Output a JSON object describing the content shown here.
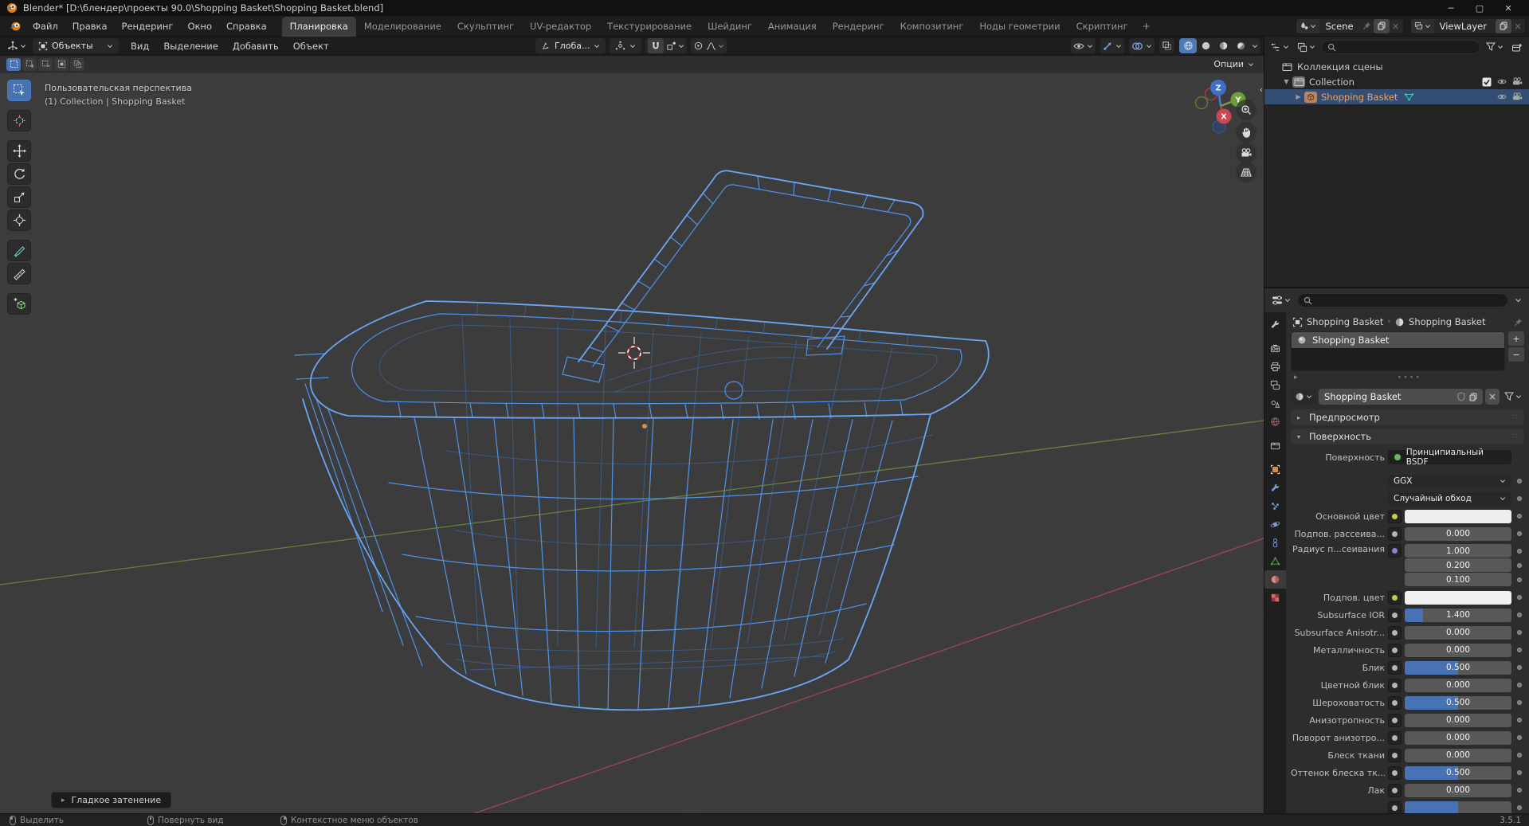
{
  "window": {
    "title": "Blender* [D:\\блендер\\проекты 90.0\\Shopping Basket\\Shopping Basket.blend]"
  },
  "topbar": {
    "menus": [
      {
        "slug": "file",
        "label": "Файл"
      },
      {
        "slug": "edit",
        "label": "Правка"
      },
      {
        "slug": "render",
        "label": "Рендеринг"
      },
      {
        "slug": "window",
        "label": "Окно"
      },
      {
        "slug": "help",
        "label": "Справка"
      }
    ],
    "workspaces": [
      {
        "slug": "layout",
        "label": "Планировка",
        "active": true
      },
      {
        "slug": "modeling",
        "label": "Моделирование"
      },
      {
        "slug": "sculpting",
        "label": "Скульптинг"
      },
      {
        "slug": "uv-editing",
        "label": "UV-редактор"
      },
      {
        "slug": "texture-paint",
        "label": "Текстурирование"
      },
      {
        "slug": "shading",
        "label": "Шейдинг"
      },
      {
        "slug": "animation",
        "label": "Анимация"
      },
      {
        "slug": "rendering",
        "label": "Рендеринг"
      },
      {
        "slug": "compositing",
        "label": "Композитинг"
      },
      {
        "slug": "geometry-nodes",
        "label": "Ноды геометрии"
      },
      {
        "slug": "scripting",
        "label": "Скриптинг"
      }
    ],
    "add_workspace": "+",
    "scene": {
      "value": "Scene"
    },
    "view_layer": {
      "value": "ViewLayer"
    }
  },
  "viewport": {
    "header": {
      "mode": "Объекты",
      "menus": [
        {
          "slug": "view",
          "label": "Вид"
        },
        {
          "slug": "select",
          "label": "Выделение"
        },
        {
          "slug": "add",
          "label": "Добавить"
        },
        {
          "slug": "object",
          "label": "Объект"
        }
      ],
      "orientation": "Глоба...",
      "options": "Опции"
    },
    "tools": [
      {
        "slug": "select-box",
        "active": true
      },
      {
        "slug": "cursor"
      },
      {
        "slug": "move"
      },
      {
        "slug": "rotate"
      },
      {
        "slug": "scale"
      },
      {
        "slug": "transform"
      },
      {
        "slug": "annotate"
      },
      {
        "slug": "measure"
      },
      {
        "slug": "add-cube"
      }
    ],
    "overlay": {
      "view_name": "Пользовательская перспектива",
      "context": "(1) Collection | Shopping Basket"
    },
    "gizmo_axes": [
      "Z",
      "Y",
      "X"
    ],
    "operator_panel": "Гладкое затенение"
  },
  "outliner": {
    "rows": [
      {
        "slug": "scene-collection",
        "label": "Коллекция сцены",
        "depth": 0
      },
      {
        "slug": "collection",
        "label": "Collection",
        "depth": 1,
        "expanded": true,
        "checkbox": true,
        "eye": true,
        "camera": true
      },
      {
        "slug": "shopping-basket",
        "label": "Shopping Basket",
        "depth": 2,
        "selected": true,
        "modifier": true,
        "eye": true,
        "camera": true
      }
    ]
  },
  "properties": {
    "tabs": [
      {
        "slug": "tool"
      },
      {
        "slug": "render"
      },
      {
        "slug": "output"
      },
      {
        "slug": "view-layer"
      },
      {
        "slug": "scene"
      },
      {
        "slug": "world"
      },
      {
        "slug": "collection"
      },
      {
        "slug": "object"
      },
      {
        "slug": "modifiers"
      },
      {
        "slug": "particles"
      },
      {
        "slug": "physics"
      },
      {
        "slug": "constraints"
      },
      {
        "slug": "object-data"
      },
      {
        "slug": "material",
        "active": true
      },
      {
        "slug": "texture"
      }
    ],
    "breadcrumb": {
      "object": "Shopping Basket",
      "material": "Shopping Basket"
    },
    "slot": {
      "name": "Shopping Basket"
    },
    "datablock": {
      "name": "Shopping Basket"
    },
    "panels": [
      {
        "slug": "preview",
        "label": "Предпросмотр",
        "expanded": false
      },
      {
        "slug": "surface",
        "label": "Поверхность",
        "expanded": true
      }
    ],
    "fields": [
      {
        "type": "ref",
        "label": "Поверхность",
        "value": "Принципиальный BSDF",
        "socket": "#63b763"
      },
      {
        "type": "select",
        "value": "GGX",
        "gap": true
      },
      {
        "type": "select",
        "value": "Случайный обход"
      },
      {
        "type": "color",
        "label": "Основной цвет",
        "socket": "#c9c94a",
        "swatch": "#eceef0"
      },
      {
        "type": "num",
        "label": "Подпов. рассеива...",
        "value": "0.000",
        "fill": 0
      },
      {
        "type": "vec3",
        "label": "Радиус п...сеивания",
        "socket": "#8d7fd6",
        "values": [
          "1.000",
          "0.200",
          "0.100"
        ]
      },
      {
        "type": "color",
        "label": "Подпов. цвет",
        "socket": "#c9c94a",
        "swatch": "#f1f1f4"
      },
      {
        "type": "num",
        "label": "Subsurface IOR",
        "value": "1.400",
        "fill": 0.17
      },
      {
        "type": "num",
        "label": "Subsurface Anisotr...",
        "value": "0.000",
        "fill": 0
      },
      {
        "type": "num",
        "label": "Металличность",
        "value": "0.000",
        "fill": 0
      },
      {
        "type": "num",
        "label": "Блик",
        "value": "0.500",
        "fill": 0.5
      },
      {
        "type": "num",
        "label": "Цветной блик",
        "value": "0.000",
        "fill": 0
      },
      {
        "type": "num",
        "label": "Шероховатость",
        "value": "0.500",
        "fill": 0.5
      },
      {
        "type": "num",
        "label": "Анизотропность",
        "value": "0.000",
        "fill": 0
      },
      {
        "type": "num",
        "label": "Поворот анизотро...",
        "value": "0.000",
        "fill": 0
      },
      {
        "type": "num",
        "label": "Блеск ткани",
        "value": "0.000",
        "fill": 0
      },
      {
        "type": "num",
        "label": "Оттенок блеска тк...",
        "value": "0.500",
        "fill": 0.5
      },
      {
        "type": "num",
        "label": "Лак",
        "value": "0.000",
        "fill": 0
      },
      {
        "type": "num",
        "label": "",
        "value": "",
        "fill": 0.5
      }
    ]
  },
  "statusbar": {
    "hints": [
      {
        "slug": "select",
        "button": "left",
        "label": "Выделить"
      },
      {
        "slug": "rotate-view",
        "button": "middle",
        "label": "Повернуть вид"
      },
      {
        "slug": "object-context-menu",
        "button": "right",
        "label": "Контекстное меню объектов"
      }
    ],
    "version": "3.5.1"
  },
  "icons": {
    "search-icon": "magnifier",
    "filter-icon": "funnel",
    "pin-icon": "pin",
    "copy-icon": "two-pages",
    "close-icon": "cross",
    "eye-icon": "eye",
    "camera-icon": "movie-camera",
    "checkbox-icon": "checked-box",
    "magnet-icon": "snap-magnet",
    "chevron-down-icon": "v",
    "blender-logo-icon": "orange-swirl",
    "modifier-icon": "teal-triangle",
    "collection-icon": "archive-box",
    "material-icon": "red-sphere"
  },
  "colors": {
    "accent": "#4772b3",
    "selection": "#334d73",
    "wireframe": "#4f93e8",
    "active_text": "#eda360",
    "axis_x": "#a84a50",
    "axis_y": "#6b8f3f",
    "viewport_bg": "#3c3c3c"
  }
}
